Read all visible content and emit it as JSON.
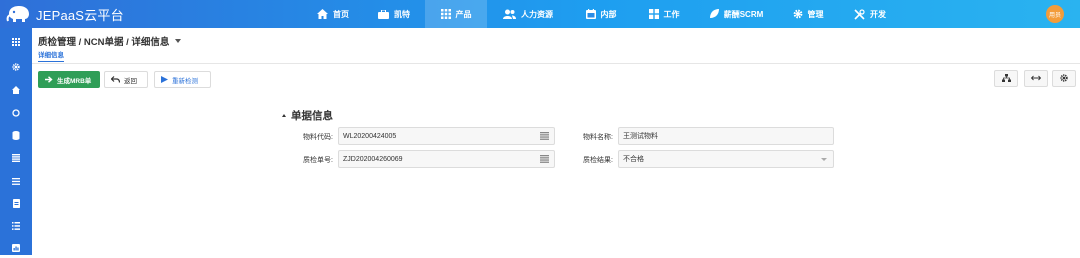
{
  "app": {
    "title": "JEPaaS云平台",
    "accent": "#2b72d9"
  },
  "nav": [
    {
      "label": "首页",
      "icon": "home-icon"
    },
    {
      "label": "凯特",
      "icon": "briefcase-icon"
    },
    {
      "label": "产品",
      "icon": "grid-icon",
      "active": true
    },
    {
      "label": "人力资源",
      "icon": "users-icon"
    },
    {
      "label": "内部",
      "icon": "calendar-icon"
    },
    {
      "label": "工作",
      "icon": "apps-icon"
    },
    {
      "label": "薪酬SCRM",
      "icon": "leaf-icon"
    },
    {
      "label": "管理",
      "icon": "gear-icon"
    },
    {
      "label": "开发",
      "icon": "tools-icon"
    }
  ],
  "user": {
    "avatar_text": "用员"
  },
  "sidebar": {
    "icons": [
      "apps-icon",
      "gear-icon",
      "home-icon",
      "circle-icon",
      "database-icon",
      "list-icon",
      "menu-icon",
      "file-icon",
      "list-alt-icon",
      "report-icon"
    ]
  },
  "page": {
    "breadcrumb": "质检管理 / NCN单据 / 详细信息",
    "subtab": "详细信息"
  },
  "toolbar": {
    "generate_label": "生成MRB单",
    "back_label": "返回",
    "recheck_label": "重新检测"
  },
  "form": {
    "section_title": "单据信息",
    "material_code_label": "物料代码:",
    "material_code_value": "WL20200424005",
    "material_name_label": "物料名称:",
    "material_name_value": "王测试物料",
    "inspection_no_label": "质检单号:",
    "inspection_no_value": "ZJD202004260069",
    "inspection_result_label": "质检结果:",
    "inspection_result_value": "不合格"
  }
}
